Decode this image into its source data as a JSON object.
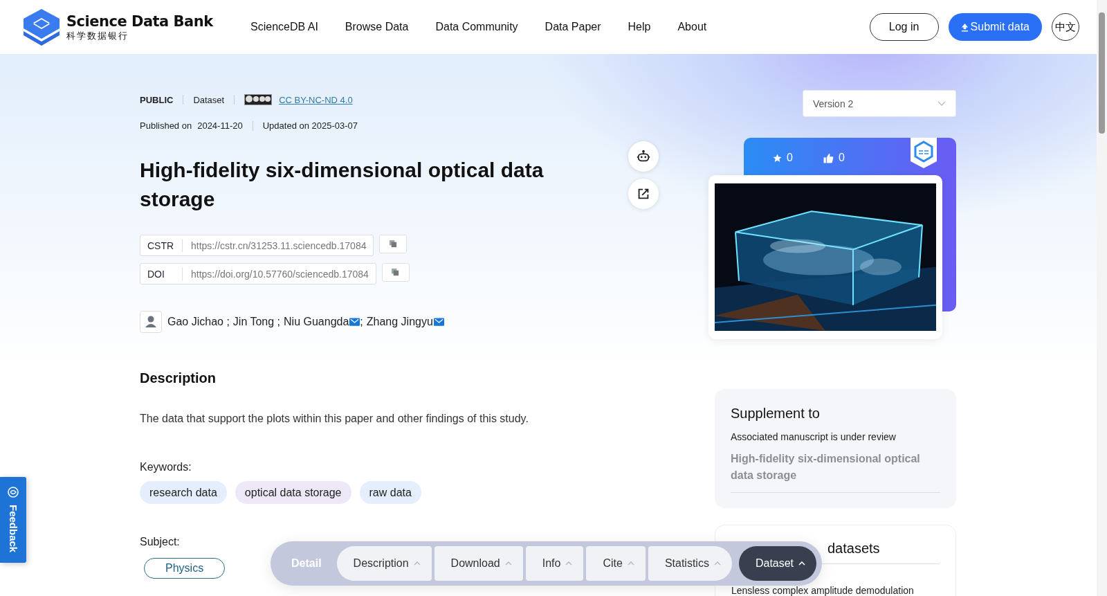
{
  "header": {
    "logo_title": "Science Data Bank",
    "logo_subtitle": "科学数据银行",
    "nav": [
      "ScienceDB AI",
      "Browse Data",
      "Data Community",
      "Data Paper",
      "Help",
      "About"
    ],
    "login": "Log in",
    "submit": "Submit data",
    "language": "中文"
  },
  "meta": {
    "visibility": "PUBLIC",
    "type": "Dataset",
    "license": "CC BY-NC-ND 4.0",
    "published_label": "Published on",
    "published": "2024-11-20",
    "updated": "Updated on 2025-03-07"
  },
  "version": "Version 2",
  "title": "High-fidelity six-dimensional optical data storage",
  "identifiers": [
    {
      "label": "CSTR",
      "value": "https://cstr.cn/31253.11.sciencedb.17084"
    },
    {
      "label": "DOI",
      "value": "https://doi.org/10.57760/sciencedb.17084"
    }
  ],
  "authors": [
    {
      "name": "Gao Jichao",
      "email": false,
      "sep": " ;"
    },
    {
      "name": "Jin Tong",
      "email": false,
      "sep": " ;"
    },
    {
      "name": "Niu Guangda",
      "email": true,
      "sep": ";"
    },
    {
      "name": "Zhang Jingyu",
      "email": true
    }
  ],
  "counts": {
    "favorites": "0",
    "likes": "0"
  },
  "description": {
    "heading": "Description",
    "text": "The data that support the plots within this paper and other findings of this study."
  },
  "keywords": {
    "label": "Keywords:",
    "items": [
      {
        "text": "research data",
        "color": "#e4eefc"
      },
      {
        "text": "optical data storage",
        "color": "#ede7f7"
      },
      {
        "text": "raw data",
        "color": "#e4eefc"
      }
    ]
  },
  "subject": {
    "label": "Subject:",
    "items": [
      "Physics"
    ]
  },
  "supplement": {
    "heading": "Supplement to",
    "note": "Associated manuscript is under review",
    "paper": "High-fidelity six-dimensional optical data storage"
  },
  "related": {
    "heading": "datasets",
    "items": [
      "Lensless complex amplitude demodulation"
    ]
  },
  "feedback": "Feedback",
  "section_nav": {
    "label": "Detail",
    "items": [
      {
        "label": "Description",
        "selected": false
      },
      {
        "label": "Download",
        "selected": false
      },
      {
        "label": "Info",
        "selected": false
      },
      {
        "label": "Cite",
        "selected": false
      },
      {
        "label": "Statistics",
        "selected": false
      },
      {
        "label": "Dataset",
        "selected": true
      }
    ]
  }
}
